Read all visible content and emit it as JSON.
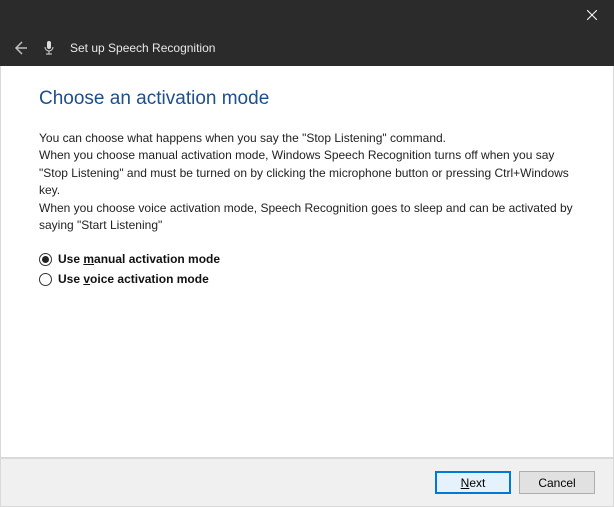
{
  "window": {
    "title": "Set up Speech Recognition"
  },
  "page": {
    "heading": "Choose an activation mode",
    "description": "You can choose what happens when you say the \"Stop Listening\" command.\nWhen you choose manual activation mode, Windows Speech Recognition turns off when you say \"Stop Listening\" and must be turned on by clicking the microphone button or pressing Ctrl+Windows key.\nWhen you choose voice activation mode, Speech Recognition goes to sleep and can be activated by saying \"Start Listening\""
  },
  "options": {
    "manual": {
      "label_pre": "Use ",
      "label_accel": "m",
      "label_post": "anual activation mode",
      "selected": true
    },
    "voice": {
      "label_pre": "Use ",
      "label_accel": "v",
      "label_post": "oice activation mode",
      "selected": false
    }
  },
  "buttons": {
    "next_accel": "N",
    "next_post": "ext",
    "cancel": "Cancel"
  }
}
